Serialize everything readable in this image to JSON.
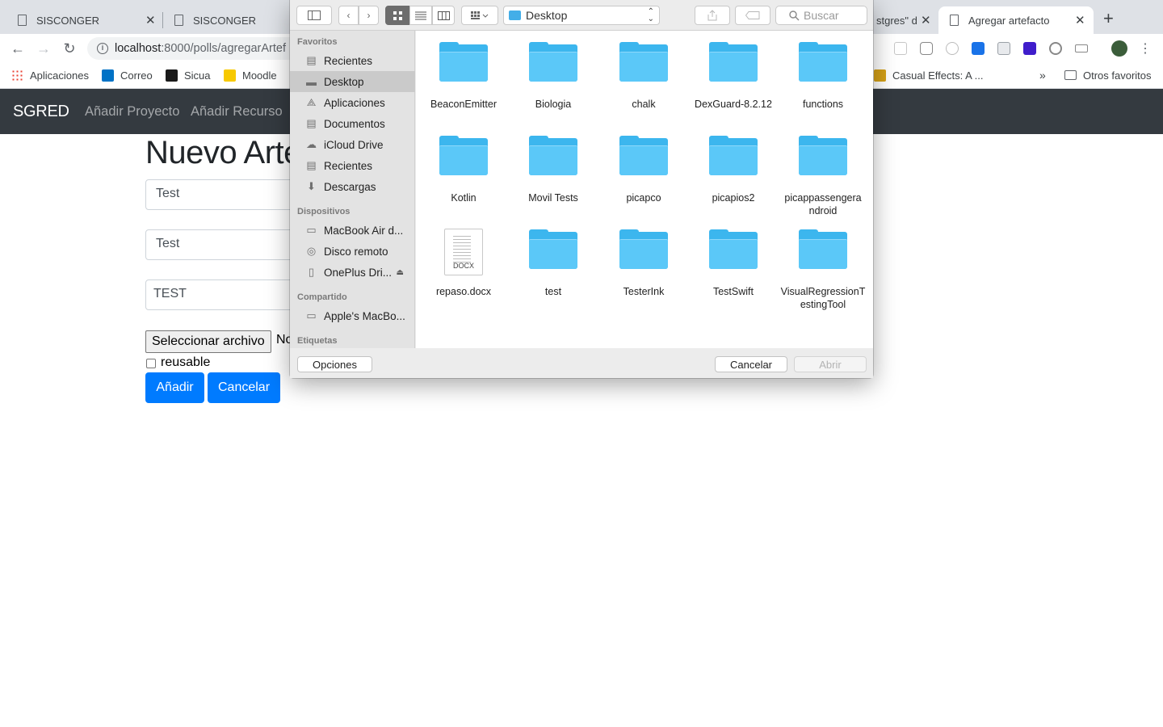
{
  "browser": {
    "tabs": [
      {
        "title": "SISCONGER"
      },
      {
        "title": "SISCONGER"
      },
      {
        "title": "stgres\" d"
      },
      {
        "title": "Agregar artefacto"
      }
    ],
    "url_host": "localhost",
    "url_path": ":8000/polls/agregarArtef",
    "bookmarks": [
      {
        "label": "Aplicaciones",
        "color": "#4285f4"
      },
      {
        "label": "Correo",
        "color": "#0072c6"
      },
      {
        "label": "Sicua",
        "color": "#1a1a1a"
      },
      {
        "label": "Moodle",
        "color": "#f7c900"
      },
      {
        "label": "Casual Effects: A ...",
        "color": "#d4a017"
      },
      {
        "label": "Otros favoritos",
        "color": "#5f6368"
      }
    ],
    "bookmarks_overflow": "»"
  },
  "page": {
    "brand": "SGRED",
    "nav": [
      "Añadir Proyecto",
      "Añadir Recurso"
    ],
    "title": "Nuevo Artefacto",
    "fields": [
      "Test",
      "Test",
      "TEST"
    ],
    "file_button": "Seleccionar archivo",
    "file_status": "No",
    "checkbox_label": "reusable",
    "submit": "Añadir",
    "cancel": "Cancelar",
    "accent": "#007bff"
  },
  "dialog": {
    "location": "Desktop",
    "search_placeholder": "Buscar",
    "sections": {
      "favorites": "Favoritos",
      "devices": "Dispositivos",
      "shared": "Compartido",
      "tags": "Etiquetas"
    },
    "favorites": [
      "Recientes",
      "Desktop",
      "Aplicaciones",
      "Documentos",
      "iCloud Drive",
      "Recientes",
      "Descargas"
    ],
    "devices": [
      "MacBook Air d...",
      "Disco remoto",
      "OnePlus Dri..."
    ],
    "shared": [
      "Apple's MacBo..."
    ],
    "items": [
      {
        "name": "BeaconEmitter",
        "kind": "folder"
      },
      {
        "name": "Biologia",
        "kind": "folder"
      },
      {
        "name": "chalk",
        "kind": "folder"
      },
      {
        "name": "DexGuard-8.2.12",
        "kind": "folder"
      },
      {
        "name": "functions",
        "kind": "folder"
      },
      {
        "name": "Kotlin",
        "kind": "folder"
      },
      {
        "name": "Movil Tests",
        "kind": "folder"
      },
      {
        "name": "picapco",
        "kind": "folder"
      },
      {
        "name": "picapios2",
        "kind": "folder"
      },
      {
        "name": "picappassengera ndroid",
        "kind": "folder"
      },
      {
        "name": "repaso.docx",
        "kind": "docx"
      },
      {
        "name": "test",
        "kind": "folder"
      },
      {
        "name": "TesterInk",
        "kind": "folder"
      },
      {
        "name": "TestSwift",
        "kind": "folder"
      },
      {
        "name": "VisualRegressionT estingTool",
        "kind": "folder"
      }
    ],
    "docx_label": "DOCX",
    "options_button": "Opciones",
    "cancel_button": "Cancelar",
    "open_button": "Abrir"
  }
}
